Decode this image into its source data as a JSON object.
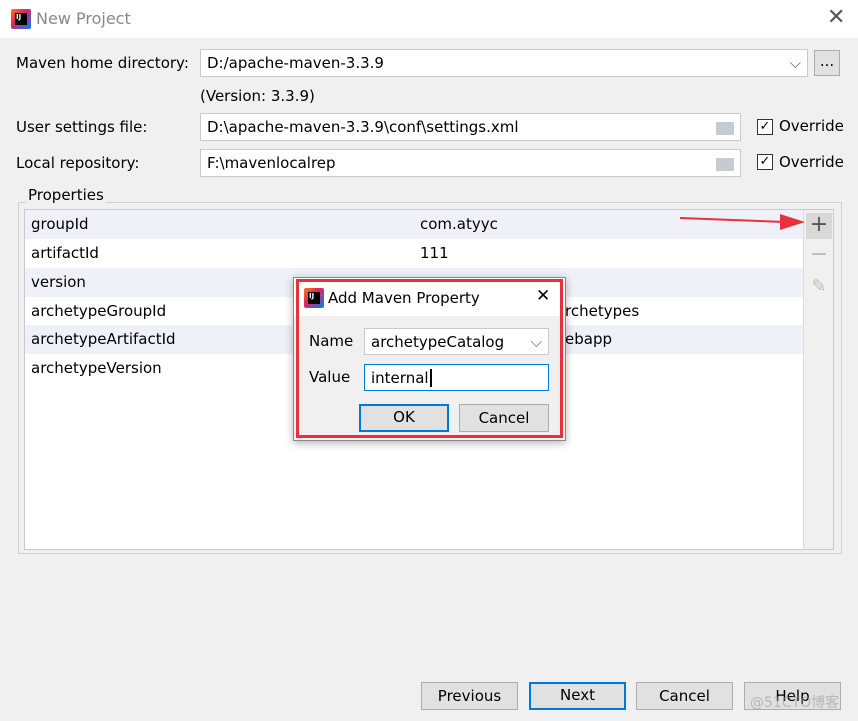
{
  "window": {
    "title": "New Project",
    "close_icon": "close-icon"
  },
  "form": {
    "maven_home_label": "Maven home directory:",
    "maven_home_value": "D:/apache-maven-3.3.9",
    "browse_label": "...",
    "version_text": "(Version: 3.3.9)",
    "settings_label": "User settings file:",
    "settings_value": "D:\\apache-maven-3.3.9\\conf\\settings.xml",
    "settings_override": "Override",
    "settings_override_checked": true,
    "repo_label": "Local repository:",
    "repo_value": "F:\\mavenlocalrep",
    "repo_override": "Override",
    "repo_override_checked": true
  },
  "properties": {
    "legend": "Properties",
    "rows": [
      {
        "key": "groupId",
        "value": "com.atyyc"
      },
      {
        "key": "artifactId",
        "value": "111"
      },
      {
        "key": "version",
        "value": ""
      },
      {
        "key": "archetypeGroupId",
        "value": "rchetypes"
      },
      {
        "key": "archetypeArtifactId",
        "value": "ebapp"
      },
      {
        "key": "archetypeVersion",
        "value": ""
      }
    ],
    "toolbar": [
      "plus-icon",
      "minus-icon",
      "pencil-icon"
    ]
  },
  "dialog": {
    "title": "Add Maven Property",
    "name_label": "Name",
    "name_value": "archetypeCatalog",
    "value_label": "Value",
    "value_value": "internal",
    "ok_label": "OK",
    "cancel_label": "Cancel"
  },
  "footer": {
    "previous": "Previous",
    "next": "Next",
    "cancel": "Cancel",
    "help": "Help"
  },
  "watermark": "@51CTO博客",
  "colors": {
    "annotation": "#e8313a",
    "focus": "#0078d7",
    "stripe": "#eef2f8"
  }
}
